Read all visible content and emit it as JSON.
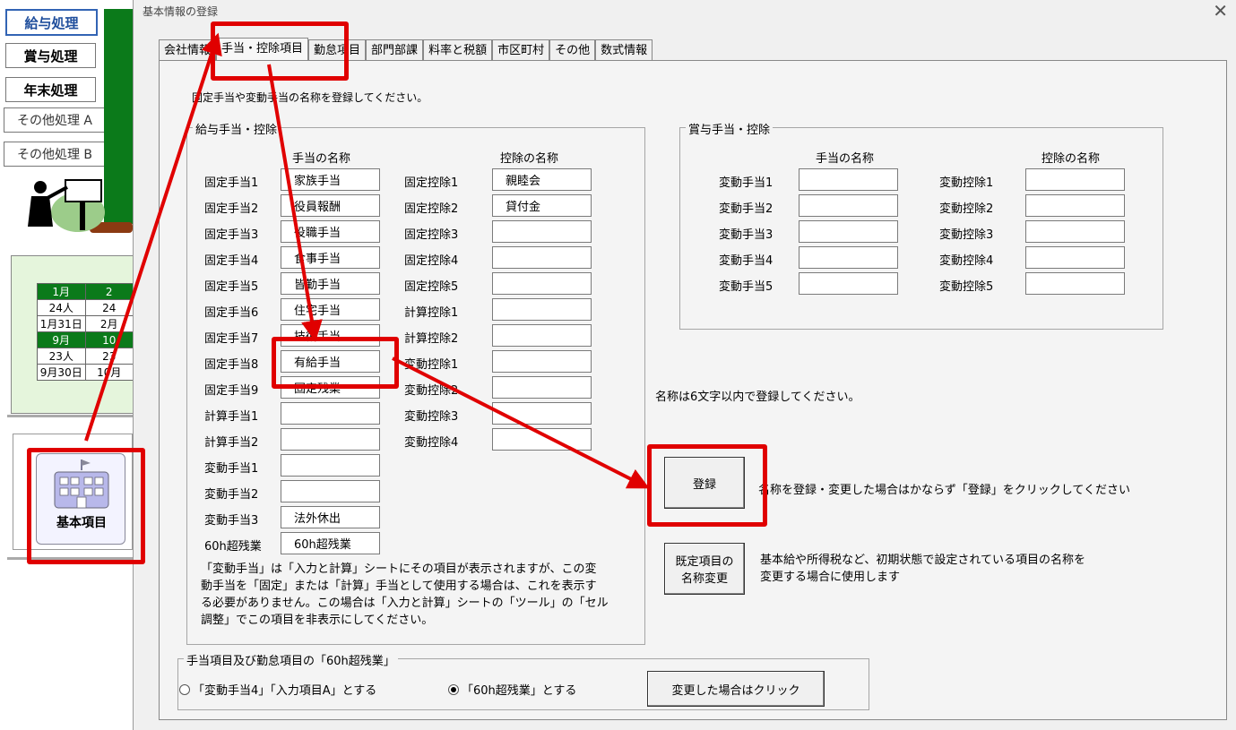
{
  "background_sheet": {
    "menu": [
      "給与処理",
      "賞与処理",
      "年末処理",
      "その他処理 A",
      "その他処理 B"
    ],
    "calendar": {
      "row1": [
        "1月",
        "2"
      ],
      "row2": [
        "24人",
        "24"
      ],
      "row3": [
        "1月31日",
        "2月"
      ],
      "row4": [
        "9月",
        "10"
      ],
      "row5": [
        "23人",
        "23"
      ],
      "row6": [
        "9月30日",
        "10月"
      ]
    },
    "basic_items_label": "基本項目",
    "colors": {
      "green": "#0b7a1a",
      "highlight": "#e00000"
    }
  },
  "dialog": {
    "title": "基本情報の登録",
    "close_icon": "close-icon",
    "tabs": [
      "会社情報",
      "手当・控除項目",
      "勤怠項目",
      "部門部課",
      "料率と税額",
      "市区町村",
      "その他",
      "数式情報"
    ],
    "active_tab": 1,
    "instruction": "固定手当や変動手当の名称を登録してください。",
    "pay_group": {
      "title": "給与手当・控除",
      "allowance_header": "手当の名称",
      "deduction_header": "控除の名称",
      "allowances": [
        {
          "label": "固定手当1",
          "value": "家族手当"
        },
        {
          "label": "固定手当2",
          "value": "役員報酬"
        },
        {
          "label": "固定手当3",
          "value": "役職手当"
        },
        {
          "label": "固定手当4",
          "value": "食事手当"
        },
        {
          "label": "固定手当5",
          "value": "皆勤手当"
        },
        {
          "label": "固定手当6",
          "value": "住宅手当"
        },
        {
          "label": "固定手当7",
          "value": "技術手当"
        },
        {
          "label": "固定手当8",
          "value": "有給手当"
        },
        {
          "label": "固定手当9",
          "value": "固定残業"
        },
        {
          "label": "計算手当1",
          "value": ""
        },
        {
          "label": "計算手当2",
          "value": ""
        },
        {
          "label": "変動手当1",
          "value": ""
        },
        {
          "label": "変動手当2",
          "value": ""
        },
        {
          "label": "変動手当3",
          "value": "法外休出"
        },
        {
          "label": "60h超残業",
          "value": "60h超残業"
        }
      ],
      "deductions": [
        {
          "label": "固定控除1",
          "value": "親睦会"
        },
        {
          "label": "固定控除2",
          "value": "貸付金"
        },
        {
          "label": "固定控除3",
          "value": ""
        },
        {
          "label": "固定控除4",
          "value": ""
        },
        {
          "label": "固定控除5",
          "value": ""
        },
        {
          "label": "計算控除1",
          "value": ""
        },
        {
          "label": "計算控除2",
          "value": ""
        },
        {
          "label": "変動控除1",
          "value": ""
        },
        {
          "label": "変動控除2",
          "value": ""
        },
        {
          "label": "変動控除3",
          "value": ""
        },
        {
          "label": "変動控除4",
          "value": ""
        }
      ],
      "note_lines": [
        "「変動手当」は「入力と計算」シートにその項目が表示されますが、この変",
        "動手当を「固定」または「計算」手当として使用する場合は、これを表示す",
        "る必要がありません。この場合は「入力と計算」シートの「ツール」の「セル",
        "調整」でこの項目を非表示にしてください。"
      ]
    },
    "bonus_group": {
      "title": "賞与手当・控除",
      "allowance_header": "手当の名称",
      "deduction_header": "控除の名称",
      "allowances": [
        {
          "label": "変動手当1",
          "value": ""
        },
        {
          "label": "変動手当2",
          "value": ""
        },
        {
          "label": "変動手当3",
          "value": ""
        },
        {
          "label": "変動手当4",
          "value": ""
        },
        {
          "label": "変動手当5",
          "value": ""
        }
      ],
      "deductions": [
        {
          "label": "変動控除1",
          "value": ""
        },
        {
          "label": "変動控除2",
          "value": ""
        },
        {
          "label": "変動控除3",
          "value": ""
        },
        {
          "label": "変動控除4",
          "value": ""
        },
        {
          "label": "変動控除5",
          "value": ""
        }
      ]
    },
    "length_note": "名称は6文字以内で登録してください。",
    "register_button": "登録",
    "register_note": "名称を登録・変更した場合はかならず「登録」をクリックしてください",
    "rename_button": [
      "既定項目の",
      "名称変更"
    ],
    "rename_note": [
      "基本給や所得税など、初期状態で設定されている項目の名称を",
      "変更する場合に使用します"
    ],
    "overtime_group": {
      "title": "手当項目及び勤怠項目の「60h超残業」",
      "option1": "「変動手当4」「入力項目A」とする",
      "option2": "「60h超残業」とする",
      "selected": 2,
      "apply_button": "変更した場合はクリック"
    }
  }
}
